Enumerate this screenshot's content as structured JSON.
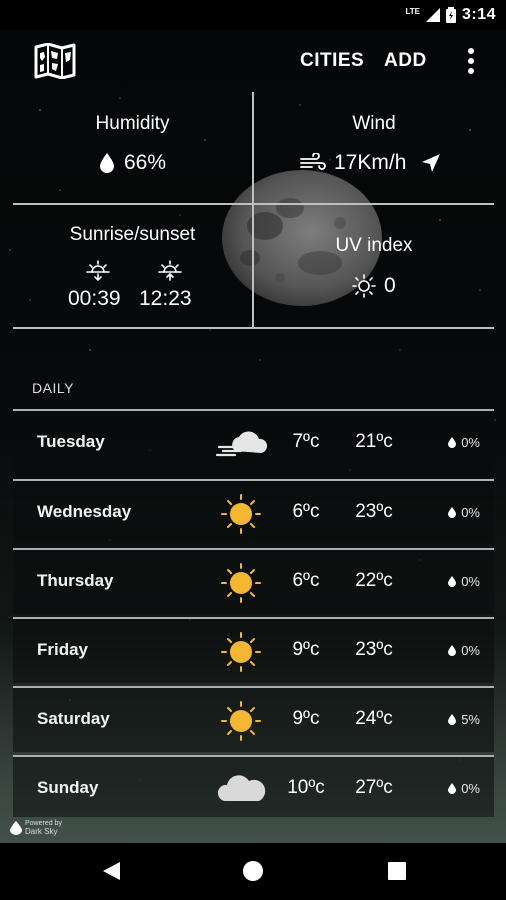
{
  "status_bar": {
    "network": "LTE",
    "time": "3:14"
  },
  "app_bar": {
    "cities_label": "CITIES",
    "add_label": "ADD"
  },
  "current": {
    "humidity": {
      "title": "Humidity",
      "value": "66%"
    },
    "wind": {
      "title": "Wind",
      "value": "17Km/h"
    },
    "sun": {
      "title": "Sunrise/sunset",
      "sunrise": "00:39",
      "sunset": "12:23"
    },
    "uv": {
      "title": "UV index",
      "value": "0"
    }
  },
  "daily": {
    "label": "DAILY",
    "days": [
      {
        "day": "Tuesday",
        "icon": "wind-cloud-icon",
        "min": "7ºc",
        "max": "21ºc",
        "precip": "0%"
      },
      {
        "day": "Wednesday",
        "icon": "sun-icon",
        "min": "6ºc",
        "max": "23ºc",
        "precip": "0%"
      },
      {
        "day": "Thursday",
        "icon": "sun-icon",
        "min": "6ºc",
        "max": "22ºc",
        "precip": "0%"
      },
      {
        "day": "Friday",
        "icon": "sun-icon",
        "min": "9ºc",
        "max": "23ºc",
        "precip": "0%"
      },
      {
        "day": "Saturday",
        "icon": "sun-icon",
        "min": "9ºc",
        "max": "24ºc",
        "precip": "5%"
      },
      {
        "day": "Sunday",
        "icon": "cloud-icon",
        "min": "10ºc",
        "max": "27ºc",
        "precip": "0%"
      }
    ]
  },
  "powered_by": {
    "line1": "Powered by",
    "line2": "Dark Sky"
  },
  "colors": {
    "sun": "#f5b731",
    "background": "#050607",
    "divider": "#bfbfbf"
  }
}
